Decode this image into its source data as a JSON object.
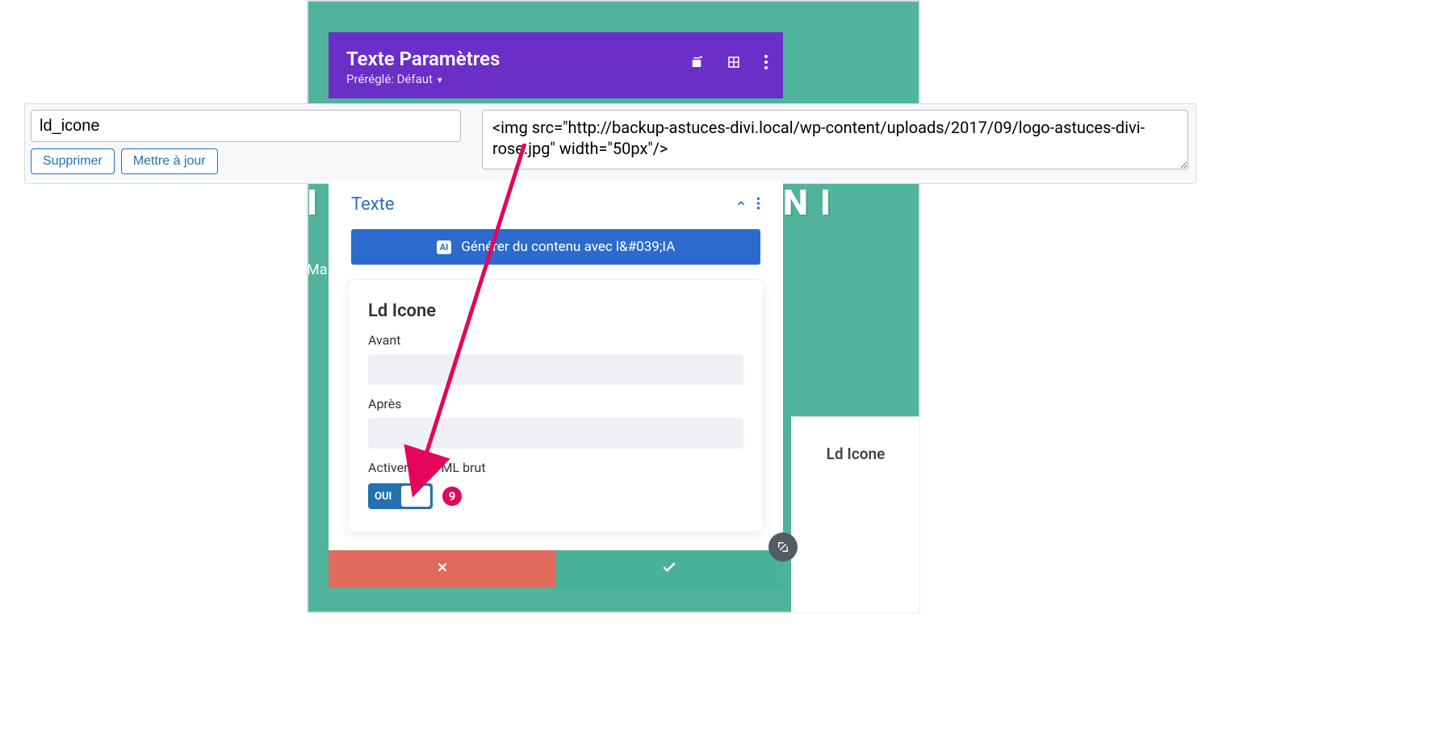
{
  "header": {
    "title": "Texte Paramètres",
    "preset_label": "Préréglé: Défaut"
  },
  "background": {
    "left_fragment": "I\nT",
    "right_fragment": "N\nI",
    "sub": "Ma"
  },
  "custom_field_bar": {
    "name_value": "ld_icone",
    "value_value": "<img src=\"http://backup-astuces-divi.local/wp-content/uploads/2017/09/logo-astuces-divi-rose.jpg\" width=\"50px\"/>",
    "btn_delete": "Supprimer",
    "btn_update": "Mettre à jour"
  },
  "panel": {
    "section_title": "Texte",
    "ai_button": "Générer du contenu avec l&#039;IA",
    "field_title": "Ld Icone",
    "before_label": "Avant",
    "after_label": "Après",
    "raw_html_label": "Activer le HTML brut",
    "toggle_on": "OUI"
  },
  "side_preview": {
    "label": "Ld Icone"
  },
  "annotation": {
    "step": "9"
  }
}
